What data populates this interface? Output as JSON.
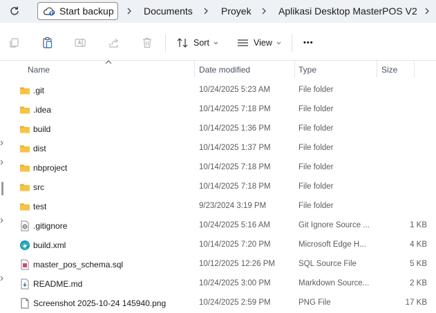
{
  "address_bar": {
    "backup_label": "Start backup",
    "breadcrumbs": [
      {
        "label": "Documents"
      },
      {
        "label": "Proyek"
      },
      {
        "label": "Aplikasi Desktop MasterPOS V2"
      }
    ]
  },
  "toolbar": {
    "sort_label": "Sort",
    "view_label": "View",
    "more_label": "•••"
  },
  "columns": {
    "name": "Name",
    "date_modified": "Date modified",
    "type": "Type",
    "size": "Size"
  },
  "files": [
    {
      "name": ".git",
      "date": "10/24/2025 5:23 AM",
      "type": "File folder",
      "size": "",
      "icon": "folder-icon"
    },
    {
      "name": ".idea",
      "date": "10/14/2025 7:18 PM",
      "type": "File folder",
      "size": "",
      "icon": "folder-icon"
    },
    {
      "name": "build",
      "date": "10/14/2025 1:36 PM",
      "type": "File folder",
      "size": "",
      "icon": "folder-icon"
    },
    {
      "name": "dist",
      "date": "10/14/2025 1:37 PM",
      "type": "File folder",
      "size": "",
      "icon": "folder-icon"
    },
    {
      "name": "nbproject",
      "date": "10/14/2025 7:18 PM",
      "type": "File folder",
      "size": "",
      "icon": "folder-icon"
    },
    {
      "name": "src",
      "date": "10/14/2025 7:18 PM",
      "type": "File folder",
      "size": "",
      "icon": "folder-icon"
    },
    {
      "name": "test",
      "date": "9/23/2024 3:19 PM",
      "type": "File folder",
      "size": "",
      "icon": "folder-icon"
    },
    {
      "name": ".gitignore",
      "date": "10/24/2025 5:16 AM",
      "type": "Git Ignore Source ...",
      "size": "1 KB",
      "icon": "gear-file-icon"
    },
    {
      "name": "build.xml",
      "date": "10/14/2025 7:20 PM",
      "type": "Microsoft Edge H...",
      "size": "4 KB",
      "icon": "edge-icon"
    },
    {
      "name": "master_pos_schema.sql",
      "date": "10/12/2025 12:26 PM",
      "type": "SQL Source File",
      "size": "5 KB",
      "icon": "sql-file-icon"
    },
    {
      "name": "README.md",
      "date": "10/24/2025 3:00 PM",
      "type": "Markdown Source...",
      "size": "2 KB",
      "icon": "markdown-file-icon"
    },
    {
      "name": "Screenshot 2025-10-24 145940.png",
      "date": "10/24/2025 2:59 PM",
      "type": "PNG File",
      "size": "17 KB",
      "icon": "image-file-icon"
    }
  ],
  "colors": {
    "address_bg": "#eef1f6",
    "folder_yellow": "#f5c443",
    "edge_blue": "#1a8cd8",
    "sql_pink": "#c74a7d"
  }
}
